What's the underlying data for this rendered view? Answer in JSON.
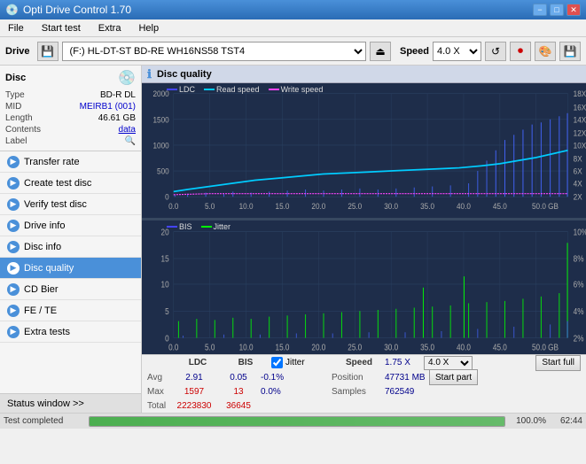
{
  "titlebar": {
    "title": "Opti Drive Control 1.70",
    "icon": "💿",
    "min": "−",
    "max": "□",
    "close": "✕"
  },
  "menubar": {
    "items": [
      "File",
      "Start test",
      "Extra",
      "Help"
    ]
  },
  "toolbar": {
    "drive_label": "Drive",
    "drive_value": "(F:)  HL-DT-ST BD-RE  WH16NS58 TST4",
    "speed_label": "Speed",
    "speed_value": "4.0 X"
  },
  "disc_panel": {
    "title": "Disc",
    "rows": [
      {
        "label": "Type",
        "value": "BD-R DL",
        "style": "normal"
      },
      {
        "label": "MID",
        "value": "MEIRB1 (001)",
        "style": "blue"
      },
      {
        "label": "Length",
        "value": "46.61 GB",
        "style": "normal"
      },
      {
        "label": "Contents",
        "value": "data",
        "style": "link"
      },
      {
        "label": "Label",
        "value": "",
        "style": "icon"
      }
    ]
  },
  "nav_items": [
    {
      "id": "transfer-rate",
      "label": "Transfer rate",
      "active": false
    },
    {
      "id": "create-test-disc",
      "label": "Create test disc",
      "active": false
    },
    {
      "id": "verify-test-disc",
      "label": "Verify test disc",
      "active": false
    },
    {
      "id": "drive-info",
      "label": "Drive info",
      "active": false
    },
    {
      "id": "disc-info",
      "label": "Disc info",
      "active": false
    },
    {
      "id": "disc-quality",
      "label": "Disc quality",
      "active": true
    },
    {
      "id": "cd-bier",
      "label": "CD Bier",
      "active": false
    },
    {
      "id": "fe-te",
      "label": "FE / TE",
      "active": false
    },
    {
      "id": "extra-tests",
      "label": "Extra tests",
      "active": false
    }
  ],
  "status_window_btn": "Status window >>",
  "disc_quality": {
    "title": "Disc quality",
    "legend": {
      "ldc_label": "LDC",
      "read_speed_label": "Read speed",
      "write_speed_label": "Write speed",
      "bis_label": "BIS",
      "jitter_label": "Jitter"
    }
  },
  "stats": {
    "avg_ldc": "2.91",
    "avg_bis": "0.05",
    "avg_jitter": "-0.1%",
    "max_ldc": "1597",
    "max_bis": "13",
    "max_jitter": "0.0%",
    "total_ldc": "2223830",
    "total_bis": "36645",
    "speed_label": "Speed",
    "speed_value": "1.75 X",
    "speed_select": "4.0 X",
    "position_label": "Position",
    "position_value": "47731 MB",
    "samples_label": "Samples",
    "samples_value": "762549",
    "start_full": "Start full",
    "start_part": "Start part",
    "jitter_checked": true,
    "jitter_label": "Jitter"
  },
  "progress": {
    "percent": "100.0%",
    "fill": 100,
    "time": "62:44"
  },
  "status": {
    "text": "Test completed"
  },
  "chart1": {
    "y_axis": [
      "2000",
      "1500",
      "1000",
      "500",
      "0"
    ],
    "y_axis_right": [
      "18X",
      "16X",
      "14X",
      "12X",
      "10X",
      "8X",
      "6X",
      "4X",
      "2X"
    ],
    "x_axis": [
      "0.0",
      "5.0",
      "10.0",
      "15.0",
      "20.0",
      "25.0",
      "30.0",
      "35.0",
      "40.0",
      "45.0",
      "50.0 GB"
    ]
  },
  "chart2": {
    "y_axis": [
      "20",
      "15",
      "10",
      "5",
      "0"
    ],
    "y_axis_right": [
      "10%",
      "8%",
      "6%",
      "4%",
      "2%"
    ],
    "x_axis": [
      "0.0",
      "5.0",
      "10.0",
      "15.0",
      "20.0",
      "25.0",
      "30.0",
      "35.0",
      "40.0",
      "45.0",
      "50.0 GB"
    ]
  },
  "colors": {
    "ldc": "#4444ff",
    "read_speed": "#00ccff",
    "write_speed": "#ff44ff",
    "bis": "#4444ff",
    "jitter": "#00ff00",
    "chart_bg": "#1a2a3a",
    "grid_line": "#2a4060",
    "active_nav": "#4a90d9"
  }
}
